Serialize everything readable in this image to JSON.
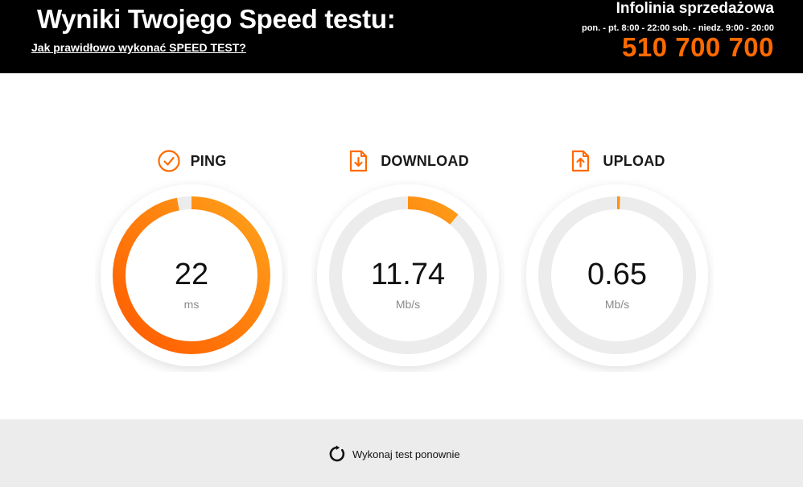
{
  "header": {
    "title": "Wyniki Twojego Speed testu:",
    "howto_link": "Jak prawidłowo wykonać SPEED TEST?"
  },
  "hotline": {
    "title": "Infolinia sprzedażowa",
    "hours": "pon. - pt. 8:00 - 22:00 sob. - niedz. 9:00 - 20:00",
    "phone": "510 700 700"
  },
  "metrics": [
    {
      "label": "PING",
      "value": "22",
      "unit": "ms",
      "fill_fraction": 0.97,
      "icon": "clock-icon"
    },
    {
      "label": "DOWNLOAD",
      "value": "11.74",
      "unit": "Mb/s",
      "fill_fraction": 0.11,
      "icon": "download-file-icon"
    },
    {
      "label": "UPLOAD",
      "value": "0.65",
      "unit": "Mb/s",
      "fill_fraction": 0.006,
      "icon": "upload-file-icon"
    }
  ],
  "footer": {
    "retest_label": "Wykonaj test ponownie",
    "retest_icon": "refresh-icon"
  },
  "colors": {
    "accent": "#ff6a00",
    "gauge_start": "#ff5a00",
    "gauge_end": "#ffa21a",
    "track": "#ececec",
    "header_bg": "#000000",
    "footer_bg": "#ececec"
  }
}
